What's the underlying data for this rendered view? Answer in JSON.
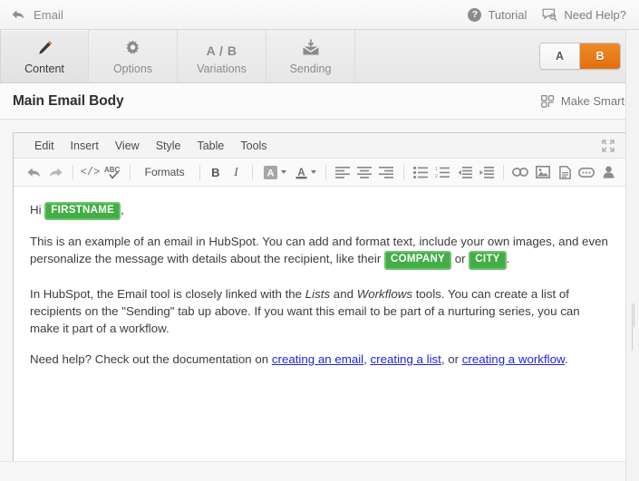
{
  "topbar": {
    "back_icon": "back-arrow-icon",
    "back_label": "Email",
    "tutorial_icon": "question-circle-icon",
    "tutorial_label": "Tutorial",
    "help_icon": "speech-bubble-search-icon",
    "help_label": "Need Help?",
    "help_glyph": "?"
  },
  "tabs": [
    {
      "label": "Content",
      "icon": "pencil-icon",
      "active": true
    },
    {
      "label": "Options",
      "icon": "gear-icon",
      "active": false
    },
    {
      "label": "Variations",
      "icon": "ab-text-icon",
      "active": false,
      "icon_text": "A / B"
    },
    {
      "label": "Sending",
      "icon": "envelope-download-icon",
      "active": false
    }
  ],
  "variation_toggle": {
    "options": [
      "A",
      "B"
    ],
    "selected": "B",
    "active_color": "#e8741c"
  },
  "section": {
    "title": "Main Email Body",
    "make_smart_label": "Make Smart",
    "make_smart_icon": "smart-blocks-icon"
  },
  "editor": {
    "menubar": [
      "Edit",
      "Insert",
      "View",
      "Style",
      "Table",
      "Tools"
    ],
    "fullscreen_icon": "fullscreen-expand-icon",
    "toolbar": [
      {
        "name": "undo-icon",
        "type": "icon",
        "glyph": "undo"
      },
      {
        "name": "redo-icon",
        "type": "icon",
        "glyph": "redo"
      },
      {
        "name": "separator",
        "type": "sep"
      },
      {
        "name": "source-code-icon",
        "type": "icon",
        "glyph": "</>"
      },
      {
        "name": "spellcheck-icon",
        "type": "icon",
        "glyph": "ABC"
      },
      {
        "name": "separator",
        "type": "sep"
      },
      {
        "name": "formats-dropdown",
        "type": "label",
        "glyph": "Formats"
      },
      {
        "name": "separator",
        "type": "sep"
      },
      {
        "name": "bold-icon",
        "type": "icon",
        "glyph": "B"
      },
      {
        "name": "italic-icon",
        "type": "icon",
        "glyph": "I"
      },
      {
        "name": "separator",
        "type": "sep"
      },
      {
        "name": "background-color-picker",
        "type": "combo",
        "glyph": "A"
      },
      {
        "name": "text-color-picker",
        "type": "combo",
        "glyph": "A"
      },
      {
        "name": "separator",
        "type": "sep"
      },
      {
        "name": "align-left-icon",
        "type": "icon",
        "glyph": "align-left"
      },
      {
        "name": "align-center-icon",
        "type": "icon",
        "glyph": "align-center"
      },
      {
        "name": "align-right-icon",
        "type": "icon",
        "glyph": "align-right"
      },
      {
        "name": "separator",
        "type": "sep"
      },
      {
        "name": "bullet-list-icon",
        "type": "icon",
        "glyph": "ul"
      },
      {
        "name": "numbered-list-icon",
        "type": "icon",
        "glyph": "ol"
      },
      {
        "name": "outdent-icon",
        "type": "icon",
        "glyph": "outdent"
      },
      {
        "name": "indent-icon",
        "type": "icon",
        "glyph": "indent"
      },
      {
        "name": "separator",
        "type": "sep"
      },
      {
        "name": "insert-link-icon",
        "type": "icon",
        "glyph": "link"
      },
      {
        "name": "insert-image-icon",
        "type": "icon",
        "glyph": "image"
      },
      {
        "name": "insert-document-icon",
        "type": "icon",
        "glyph": "document"
      },
      {
        "name": "insert-cta-icon",
        "type": "icon",
        "glyph": "cta"
      },
      {
        "name": "personalization-icon",
        "type": "icon",
        "glyph": "person"
      }
    ],
    "body": {
      "greeting_prefix": "Hi ",
      "greeting_token": "FIRSTNAME",
      "greeting_suffix": ",",
      "para2_a": "This is an example of an email in HubSpot. You can add and format text, include your own images, and even personalize the message with details about the recipient, like their ",
      "para2_token1": "COMPANY",
      "para2_mid": " or ",
      "para2_token2": "CITY",
      "para2_end": ".",
      "para3_a": "In HubSpot, the Email tool is closely linked with the ",
      "para3_em1": "Lists",
      "para3_b": " and ",
      "para3_em2": "Workflows",
      "para3_c": " tools. You can create a list of recipients on the \"Sending\" tab up above. If you want this email to be part of a nurturing series, you can make it part of a workflow.",
      "para4_a": "Need help? Check out the documentation on ",
      "para4_link1": "creating an email",
      "para4_b": ", ",
      "para4_link2": "creating a list",
      "para4_c": ", or ",
      "para4_link3": "creating a workflow",
      "para4_end": "."
    }
  },
  "scrollbar": {
    "name": "page-scrollbar"
  }
}
